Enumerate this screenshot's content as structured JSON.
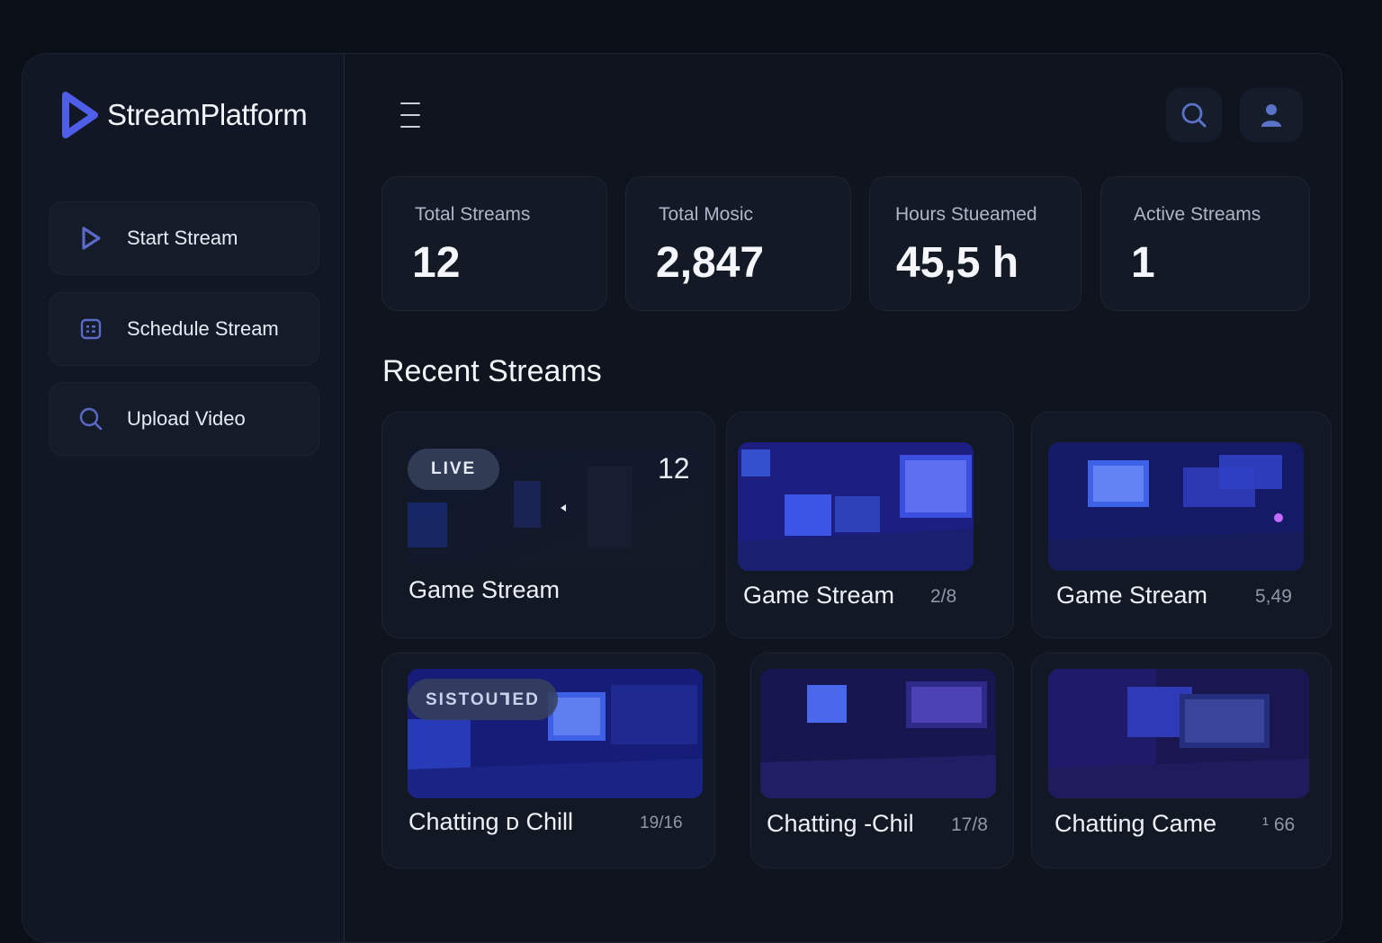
{
  "brand": {
    "name": "StreamPlatform",
    "accent": "#4f5ee8"
  },
  "sidebar": {
    "items": [
      {
        "label": "Start Stream",
        "icon": "play-icon"
      },
      {
        "label": "Schedule Stream",
        "icon": "calendar-icon"
      },
      {
        "label": "Upload Video",
        "icon": "search-icon"
      }
    ]
  },
  "header": {
    "menu_icon": "hamburger-menu-icon",
    "search_icon": "search-icon",
    "user_icon": "user-icon"
  },
  "stats": [
    {
      "label": "Total Streams",
      "value": "12"
    },
    {
      "label": "Total Mosic",
      "value": "2,847"
    },
    {
      "label": "Hours Stueamed",
      "value": "45,5 h"
    },
    {
      "label": "Active Streams",
      "value": "1"
    }
  ],
  "recent": {
    "title": "Recent Streams",
    "streams": [
      {
        "title": "Game Stream",
        "badge": "LIVE",
        "count": "12"
      },
      {
        "title": "Game Stream",
        "count": "2/8"
      },
      {
        "title": "Game Stream",
        "count": "5,49"
      },
      {
        "title": "Chatting ᴅ Chill",
        "badge": "SISTOUꞀED",
        "count": "19/16"
      },
      {
        "title": "Chatting -Chil",
        "count": "17/8"
      },
      {
        "title": "Chatting Came",
        "count": "¹ 66"
      }
    ]
  }
}
